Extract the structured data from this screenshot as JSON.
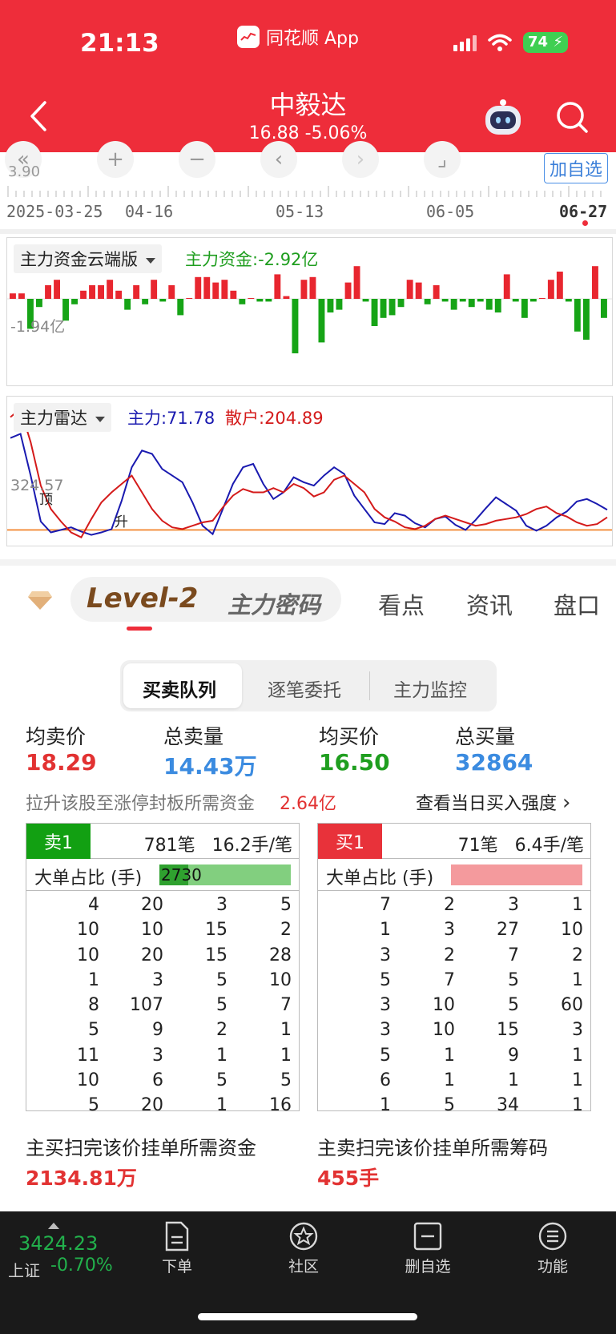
{
  "status": {
    "time": "21:13",
    "app_name": "同花顺 App",
    "battery": "74"
  },
  "stock": {
    "name": "中毅达",
    "quote": "16.88 -5.06%"
  },
  "chart_controls": {
    "add_watchlist": "加自选",
    "price_hint": "3.90"
  },
  "axis_dates": [
    "2025-03-25",
    "04-16",
    "05-13",
    "06-05",
    "06-27"
  ],
  "fund_panel": {
    "label": "主力资金云端版",
    "value": "主力资金:-2.92亿",
    "overlay": "-1.94亿"
  },
  "radar_panel": {
    "label": "主力雷达",
    "main": "主力:71.78",
    "retail": "散户:204.89",
    "overlay": "324.57",
    "mark_top": "顶",
    "mark_up": "升"
  },
  "chart_data": [
    {
      "type": "bar",
      "title": "主力资金云端版",
      "values": [
        2,
        2,
        -11,
        -3,
        5,
        7,
        -8,
        -2,
        3,
        5,
        5,
        7,
        3,
        -4,
        5,
        -2,
        7,
        -1,
        5,
        -6,
        0,
        8,
        8,
        6,
        7,
        3,
        -2,
        0,
        -1,
        -1,
        9,
        1,
        -20,
        7,
        8,
        -16,
        -5,
        -4,
        6,
        12,
        -1,
        -10,
        -7,
        -6,
        -3,
        7,
        6,
        -2,
        5,
        -1,
        -4,
        -1,
        -3,
        -1,
        -4,
        -5,
        9,
        -1,
        -7,
        -1,
        0,
        7,
        10,
        -1,
        -12,
        -15,
        12,
        -7
      ],
      "colors": {
        "positive": "#e8262f",
        "negative": "#16a416"
      }
    },
    {
      "type": "line",
      "title": "主力雷达",
      "threshold": 95,
      "series": [
        {
          "name": "主力",
          "color": "#1a1ab0",
          "values": [
            205,
            210,
            160,
            105,
            92,
            95,
            98,
            93,
            89,
            92,
            96,
            130,
            170,
            190,
            186,
            168,
            160,
            152,
            128,
            100,
            90,
            120,
            150,
            170,
            174,
            150,
            132,
            140,
            158,
            152,
            148,
            160,
            170,
            162,
            136,
            120,
            104,
            102,
            115,
            112,
            103,
            98,
            108,
            111,
            101,
            95,
            107,
            121,
            134,
            126,
            118,
            100,
            94,
            100,
            110,
            117,
            129,
            132,
            126,
            119
          ]
        },
        {
          "name": "散户",
          "color": "#d41a1a",
          "values": [
            230,
            240,
            200,
            148,
            120,
            105,
            92,
            86,
            108,
            128,
            140,
            150,
            160,
            140,
            120,
            106,
            98,
            96,
            100,
            104,
            106,
            122,
            136,
            144,
            140,
            140,
            145,
            140,
            150,
            145,
            135,
            140,
            155,
            160,
            150,
            140,
            120,
            110,
            105,
            98,
            96,
            100,
            108,
            112,
            108,
            104,
            100,
            102,
            106,
            108,
            110,
            114,
            120,
            123,
            115,
            111,
            104,
            100,
            102,
            110
          ]
        }
      ]
    }
  ],
  "tabs": {
    "level2": "Level-2",
    "zlmm": "主力密码",
    "kandian": "看点",
    "zixun": "资讯",
    "pankou": "盘口"
  },
  "subtabs": [
    "买卖队列",
    "逐笔委托",
    "主力监控"
  ],
  "stats": [
    {
      "label": "均卖价",
      "value": "18.29",
      "color": "#e23232"
    },
    {
      "label": "总卖量",
      "value": "14.43万",
      "color": "#3b8be0"
    },
    {
      "label": "均买价",
      "value": "16.50",
      "color": "#1f9e1f"
    },
    {
      "label": "总买量",
      "value": "32864",
      "color": "#3b8be0"
    }
  ],
  "promo": {
    "text": "拉升该股至涨停封板所需资金",
    "value": "2.64亿",
    "link": "查看当日买入强度"
  },
  "sell_queue": {
    "tag": "卖1",
    "count": "781笔",
    "avg": "16.2手/笔",
    "big_label": "大单占比 (手)",
    "big_value": "2730",
    "big_fraction": 0.22,
    "rows": [
      [
        "4",
        "20",
        "3",
        "5"
      ],
      [
        "10",
        "10",
        "15",
        "2"
      ],
      [
        "10",
        "20",
        "15",
        "28"
      ],
      [
        "1",
        "3",
        "5",
        "10"
      ],
      [
        "8",
        "107",
        "5",
        "7"
      ],
      [
        "5",
        "9",
        "2",
        "1"
      ],
      [
        "11",
        "3",
        "1",
        "1"
      ],
      [
        "10",
        "6",
        "5",
        "5"
      ],
      [
        "5",
        "20",
        "1",
        "16"
      ]
    ]
  },
  "buy_queue": {
    "tag": "买1",
    "count": "71笔",
    "avg": "6.4手/笔",
    "big_label": "大单占比 (手)",
    "big_value": "",
    "big_fraction": 0,
    "rows": [
      [
        "7",
        "2",
        "3",
        "1"
      ],
      [
        "1",
        "3",
        "27",
        "10"
      ],
      [
        "3",
        "2",
        "7",
        "2"
      ],
      [
        "5",
        "7",
        "5",
        "1"
      ],
      [
        "3",
        "10",
        "5",
        "60"
      ],
      [
        "3",
        "10",
        "15",
        "3"
      ],
      [
        "5",
        "1",
        "9",
        "1"
      ],
      [
        "6",
        "1",
        "1",
        "1"
      ],
      [
        "1",
        "5",
        "34",
        "1"
      ]
    ]
  },
  "sweep": {
    "buy_label": "主买扫完该价挂单所需资金",
    "buy_value": "2134.81万",
    "sell_label": "主卖扫完该价挂单所需筹码",
    "sell_value": "455手"
  },
  "index": {
    "value": "3424.23",
    "name": "上证",
    "change": "-0.70%"
  },
  "nav": {
    "order": "下单",
    "community": "社区",
    "remove_watch": "删自选",
    "functions": "功能"
  }
}
